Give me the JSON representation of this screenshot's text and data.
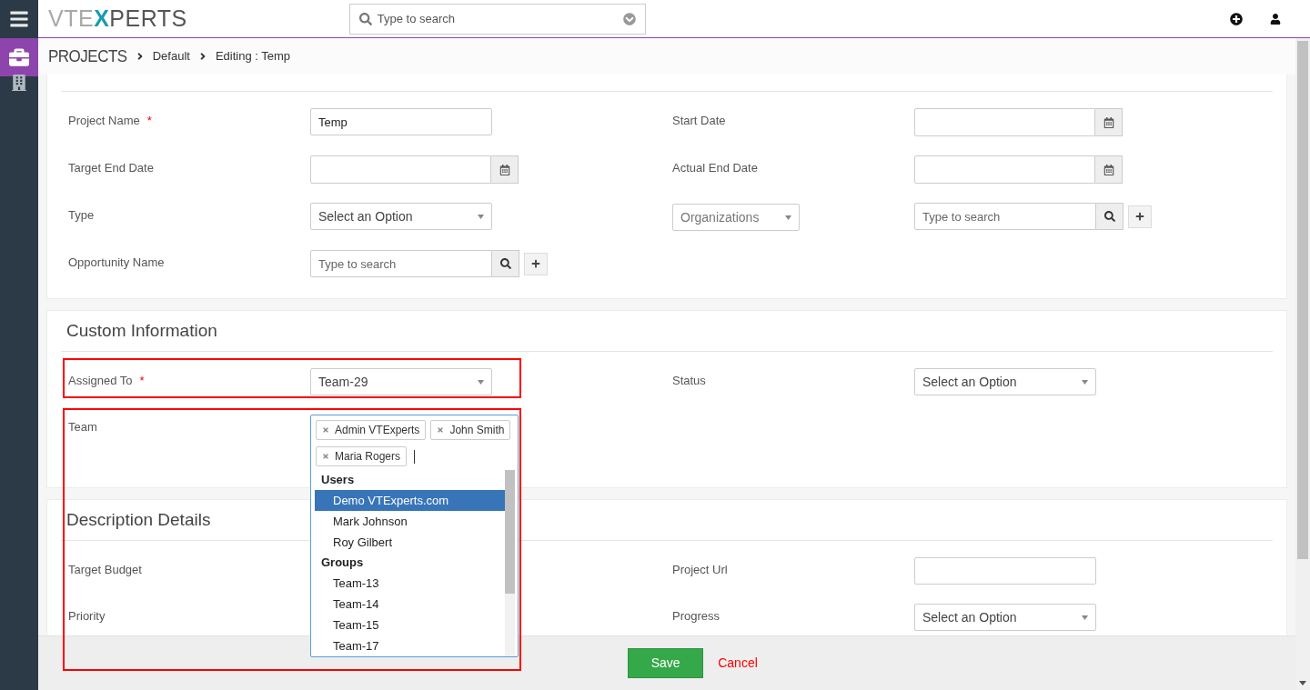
{
  "topbar": {
    "logo": "VTEXPERTS",
    "search": {
      "placeholder": "Type to search"
    }
  },
  "sidebar": {
    "items": [
      {
        "kind": "projects",
        "selected": true
      },
      {
        "kind": "organizations",
        "selected": false
      }
    ]
  },
  "breadcrumb": [
    "PROJECTS",
    "Default",
    "Editing : Temp"
  ],
  "sections": [
    {
      "fields": [
        {
          "label": "Project Name",
          "required_mark": "*",
          "kind": "text",
          "value": "Temp"
        },
        {
          "label": "Start Date",
          "kind": "date"
        },
        {
          "label": "Target End Date",
          "kind": "date"
        },
        {
          "label": "Actual End Date",
          "kind": "date"
        },
        {
          "label": "Type",
          "kind": "select",
          "value": "Select an Option"
        },
        {
          "kind": "reference",
          "module": "Organizations",
          "placeholder": "Type to search"
        },
        {
          "label": "Opportunity Name",
          "kind": "lookup",
          "placeholder": "Type to search"
        }
      ]
    },
    {
      "title": "Custom Information",
      "fields": [
        {
          "label": "Assigned To",
          "required_mark": "*",
          "kind": "select",
          "value": "Team-29",
          "highlighted": true
        },
        {
          "label": "Status",
          "kind": "select",
          "value": "Select an Option"
        },
        {
          "label": "Team",
          "kind": "multiselect",
          "highlighted": true,
          "open": true,
          "tags": [
            "Admin VTExperts",
            "John Smith",
            "Maria Rogers"
          ],
          "groups": [
            {
              "label": "Users",
              "options": [
                {
                  "label": "Demo VTExperts.com",
                  "selected": true
                },
                {
                  "label": "Mark Johnson",
                  "selected": false
                },
                {
                  "label": "Roy Gilbert",
                  "selected": false
                }
              ]
            },
            {
              "label": "Groups",
              "options": [
                {
                  "label": "Team-13",
                  "selected": false
                },
                {
                  "label": "Team-14",
                  "selected": false
                },
                {
                  "label": "Team-15",
                  "selected": false
                },
                {
                  "label": "Team-17",
                  "selected": false
                }
              ]
            }
          ]
        }
      ]
    },
    {
      "title": "Description Details",
      "fields": [
        {
          "label": "Target Budget"
        },
        {
          "label": "Project Url",
          "kind": "text"
        },
        {
          "label": "Priority"
        },
        {
          "label": "Progress",
          "kind": "select",
          "value": "Select an Option"
        }
      ]
    }
  ],
  "footer": {
    "buttons": [
      {
        "label": "Save",
        "kind": "primary"
      },
      {
        "label": "Cancel",
        "kind": "link"
      }
    ]
  }
}
